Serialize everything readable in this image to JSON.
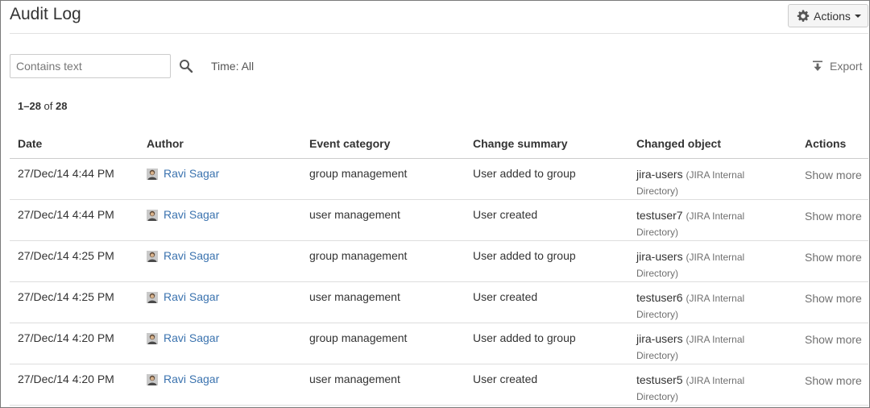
{
  "page": {
    "title": "Audit Log"
  },
  "toolbar": {
    "actions_label": "Actions"
  },
  "filters": {
    "search_placeholder": "Contains text",
    "search_value": "",
    "time_label": "Time: All",
    "export_label": "Export"
  },
  "results": {
    "range": "1–28",
    "of_label": "of",
    "total": "28"
  },
  "columns": [
    "Date",
    "Author",
    "Event category",
    "Change summary",
    "Changed object",
    "Actions"
  ],
  "rows": [
    {
      "date": "27/Dec/14 4:44 PM",
      "author": "Ravi Sagar",
      "category": "group management",
      "summary": "User added to group",
      "object": "jira-users",
      "dir_a": "(JIRA Internal",
      "dir_b": "Directory)",
      "action": "Show more"
    },
    {
      "date": "27/Dec/14 4:44 PM",
      "author": "Ravi Sagar",
      "category": "user management",
      "summary": "User created",
      "object": "testuser7",
      "dir_a": "(JIRA Internal",
      "dir_b": "Directory)",
      "action": "Show more"
    },
    {
      "date": "27/Dec/14 4:25 PM",
      "author": "Ravi Sagar",
      "category": "group management",
      "summary": "User added to group",
      "object": "jira-users",
      "dir_a": "(JIRA Internal",
      "dir_b": "Directory)",
      "action": "Show more"
    },
    {
      "date": "27/Dec/14 4:25 PM",
      "author": "Ravi Sagar",
      "category": "user management",
      "summary": "User created",
      "object": "testuser6",
      "dir_a": "(JIRA Internal",
      "dir_b": "Directory)",
      "action": "Show more"
    },
    {
      "date": "27/Dec/14 4:20 PM",
      "author": "Ravi Sagar",
      "category": "group management",
      "summary": "User added to group",
      "object": "jira-users",
      "dir_a": "(JIRA Internal",
      "dir_b": "Directory)",
      "action": "Show more"
    },
    {
      "date": "27/Dec/14 4:20 PM",
      "author": "Ravi Sagar",
      "category": "user management",
      "summary": "User created",
      "object": "testuser5",
      "dir_a": "(JIRA Internal",
      "dir_b": "Directory)",
      "action": "Show more"
    }
  ],
  "icons": {
    "gear": "gear-icon",
    "search": "search-icon",
    "export": "export-icon",
    "avatar": "avatar"
  },
  "colors": {
    "link": "#3b73af",
    "muted": "#707070",
    "border": "#cccccc"
  }
}
